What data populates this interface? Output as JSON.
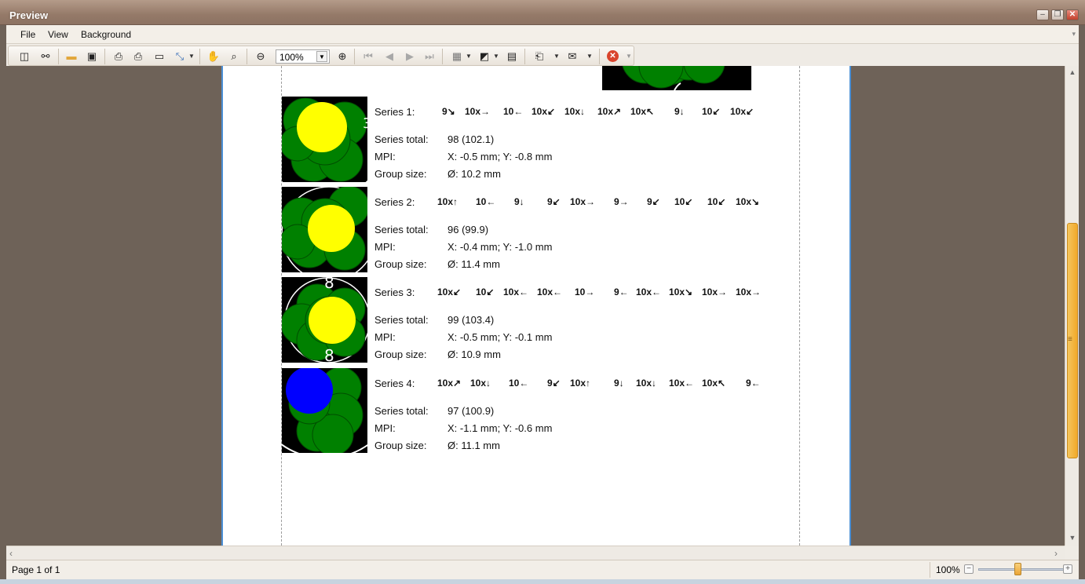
{
  "window": {
    "title": "Preview"
  },
  "menu": {
    "items": [
      "File",
      "View",
      "Background"
    ]
  },
  "toolbar": {
    "zoom_value": "100%"
  },
  "report": {
    "labels": {
      "total": "Series total:",
      "mpi": "MPI:",
      "group": "Group size:"
    },
    "series": [
      {
        "label": "Series 1:",
        "shots": [
          "9↘",
          "10x→",
          "10←",
          "10x↙",
          "10x↓",
          "10x↗",
          "10x↖",
          "9↓",
          "10↙",
          "10x↙"
        ],
        "total": "98 (102.1)",
        "mpi": "X: -0.5 mm; Y: -0.8 mm",
        "group": "Ø: 10.2 mm",
        "center_color": "#ffff00"
      },
      {
        "label": "Series 2:",
        "shots": [
          "10x↑",
          "10←",
          "9↓",
          "9↙",
          "10x→",
          "9→",
          "9↙",
          "10↙",
          "10↙",
          "10x↘"
        ],
        "total": "96 (99.9)",
        "mpi": "X: -0.4 mm; Y: -1.0 mm",
        "group": "Ø: 11.4 mm",
        "center_color": "#ffff00"
      },
      {
        "label": "Series 3:",
        "shots": [
          "10x↙",
          "10↙",
          "10x←",
          "10x←",
          "10→",
          "9←",
          "10x←",
          "10x↘",
          "10x→",
          "10x→"
        ],
        "total": "99 (103.4)",
        "mpi": "X: -0.5 mm; Y: -0.1 mm",
        "group": "Ø: 10.9 mm",
        "center_color": "#ffff00",
        "ring_labels": [
          "8",
          "8"
        ]
      },
      {
        "label": "Series 4:",
        "shots": [
          "10x↗",
          "10x↓",
          "10←",
          "9↙",
          "10x↑",
          "9↓",
          "10x↓",
          "10x←",
          "10x↖",
          "9←"
        ],
        "total": "97 (100.9)",
        "mpi": "X: -1.1 mm; Y: -0.6 mm",
        "group": "Ø: 11.1 mm",
        "center_color": "#0000ff"
      }
    ]
  },
  "status": {
    "page_info": "Page 1 of 1",
    "zoom": "100%"
  },
  "colors": {
    "shot_green": "#008000",
    "accent_blue": "#4a8fd6",
    "slider_orange": "#f1a92a"
  }
}
